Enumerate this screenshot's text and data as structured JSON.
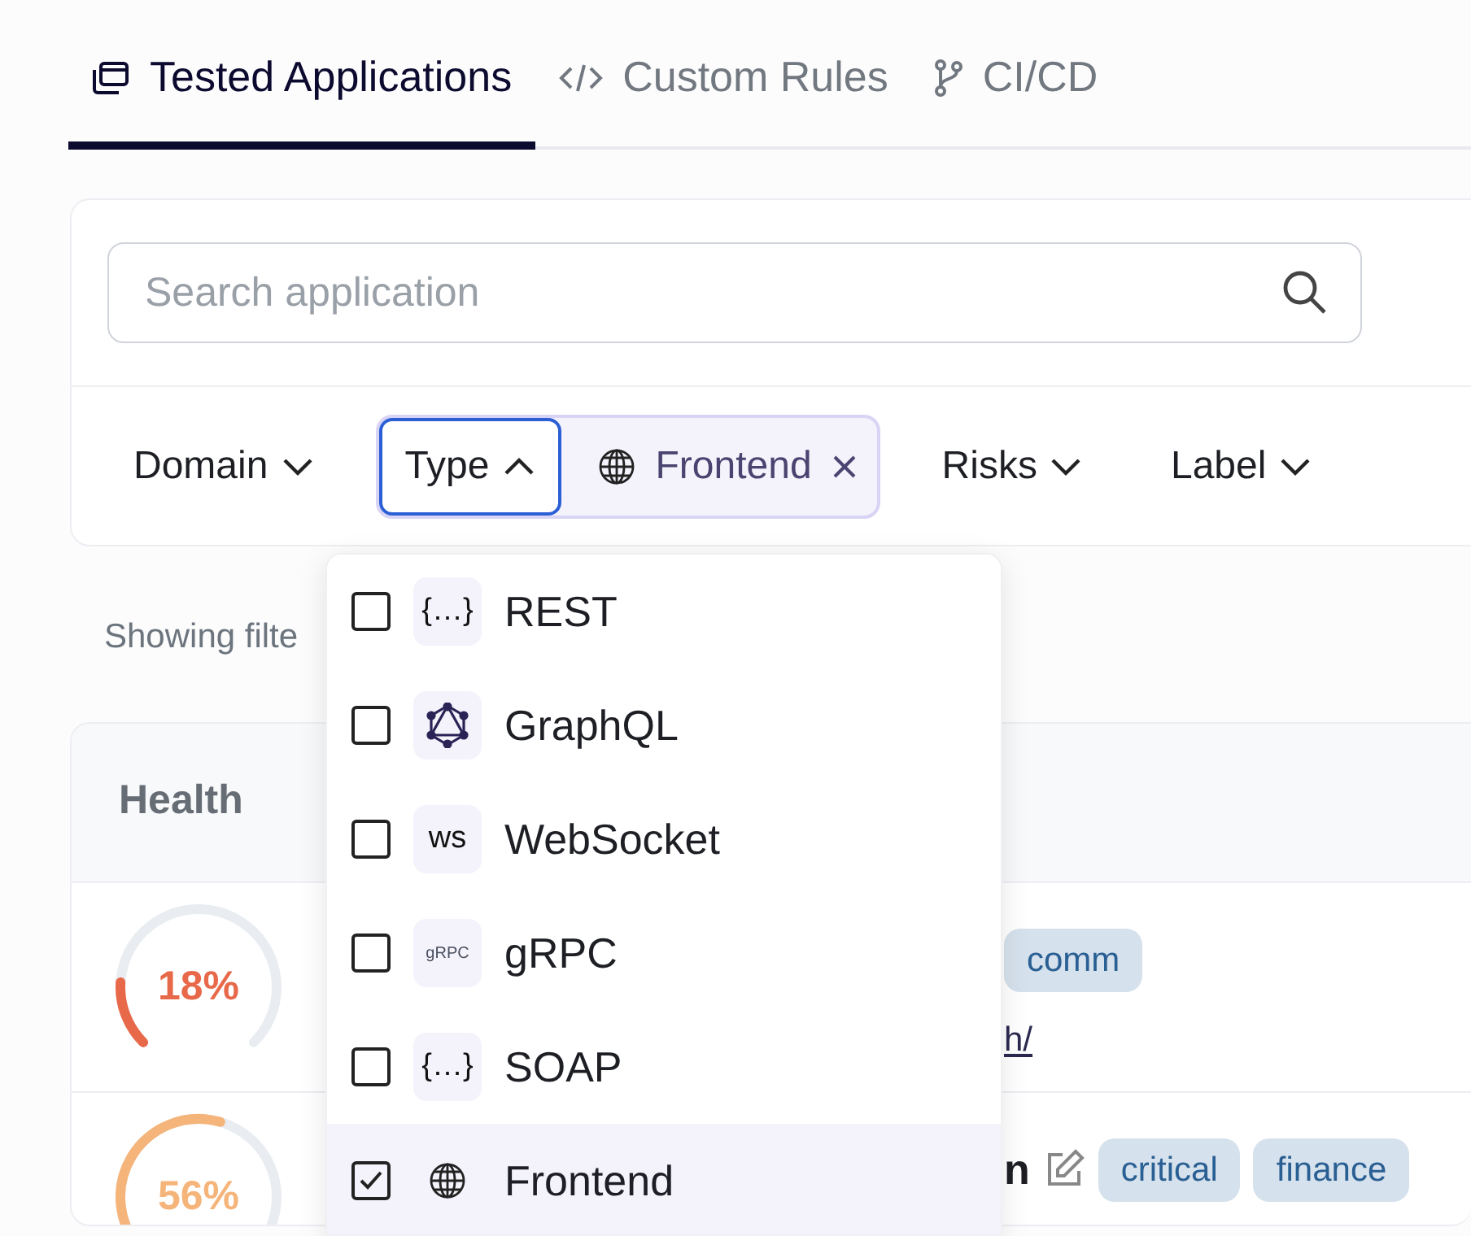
{
  "tabs": [
    {
      "label": "Tested Applications",
      "kind": "apps",
      "selected": true
    },
    {
      "label": "Custom Rules",
      "kind": "code",
      "selected": false
    },
    {
      "label": "CI/CD",
      "kind": "branch",
      "selected": false
    }
  ],
  "search": {
    "placeholder": "Search application"
  },
  "filters": [
    {
      "label": "Domain",
      "open": false
    },
    {
      "label": "Type",
      "open": true,
      "chips": [
        {
          "label": "Frontend",
          "kind": "globe"
        }
      ]
    },
    {
      "label": "Risks",
      "open": false
    },
    {
      "label": "Label",
      "open": false
    }
  ],
  "type_menu": [
    {
      "label": "REST",
      "kind": "text",
      "icon_text": "{…}",
      "checked": false
    },
    {
      "label": "GraphQL",
      "kind": "graphql",
      "checked": false
    },
    {
      "label": "WebSocket",
      "kind": "text",
      "icon_text": "ws",
      "checked": false
    },
    {
      "label": "gRPC",
      "kind": "small-text",
      "icon_text": "gRPC",
      "checked": false
    },
    {
      "label": "SOAP",
      "kind": "text",
      "icon_text": "{…}",
      "checked": false
    },
    {
      "label": "Frontend",
      "kind": "globe",
      "checked": true
    }
  ],
  "results_text": "Showing filte",
  "table": {
    "columns": [
      "Health"
    ],
    "rows": [
      {
        "health": "18%",
        "level": 0.18,
        "editable": false,
        "tags": [
          "comm"
        ],
        "link": "h/"
      },
      {
        "health": "56%",
        "level": 0.56,
        "name": "n",
        "editable": true,
        "tags": [
          "critical",
          "finance"
        ]
      }
    ]
  }
}
